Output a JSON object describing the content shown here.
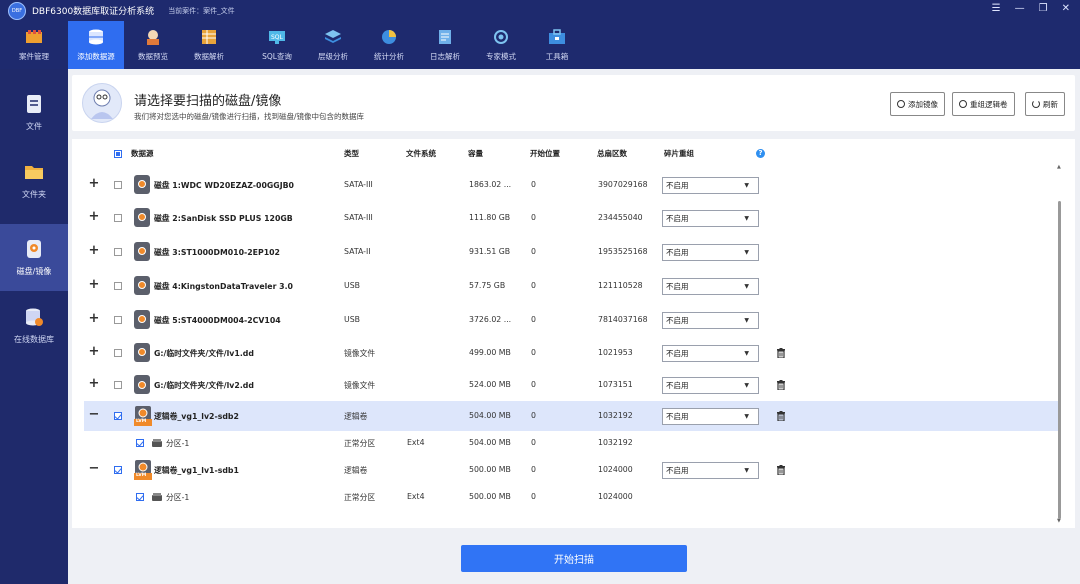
{
  "app": {
    "logo_text": "DBF",
    "title": "DBF6300数据库取证分析系统",
    "case_label": "当前案件：案件_文件"
  },
  "window_controls": [
    "☰",
    "—",
    "❐",
    "✕"
  ],
  "toolbar": [
    {
      "label": "案件管理",
      "icon": "case-icon"
    },
    {
      "label": "添加数据源",
      "icon": "add-datasource-icon",
      "active": true
    },
    {
      "label": "数据预览",
      "icon": "preview-icon"
    },
    {
      "label": "数据解析",
      "icon": "parse-icon"
    },
    {
      "label": "SQL查询",
      "icon": "sql-icon"
    },
    {
      "label": "层级分析",
      "icon": "layer-icon"
    },
    {
      "label": "统计分析",
      "icon": "stats-icon"
    },
    {
      "label": "日志解析",
      "icon": "log-icon"
    },
    {
      "label": "专家模式",
      "icon": "expert-icon"
    },
    {
      "label": "工具箱",
      "icon": "toolbox-icon"
    }
  ],
  "sidebar": [
    {
      "label": "文件",
      "icon": "file-icon"
    },
    {
      "label": "文件夹",
      "icon": "folder-icon"
    },
    {
      "label": "磁盘/镜像",
      "icon": "disk-icon",
      "active": true
    },
    {
      "label": "在线数据库",
      "icon": "database-icon"
    }
  ],
  "header": {
    "title": "请选择要扫描的磁盘/镜像",
    "subtitle": "我们将对您选中的磁盘/镜像进行扫描，找到磁盘/镜像中包含的数据库",
    "btn_add_image": "添加镜像",
    "btn_rebuild": "重组逻辑卷",
    "btn_refresh": "刷新"
  },
  "table": {
    "headers": {
      "source": "数据源",
      "type": "类型",
      "fs": "文件系统",
      "capacity": "容量",
      "start": "开始位置",
      "sectors": "总扇区数",
      "reassemble": "碎片重组"
    },
    "help": "?",
    "rows": [
      {
        "kind": "disk",
        "expander": "+",
        "name": "磁盘 1:WDC WD20EZAZ-00GGJB0",
        "type": "SATA-III",
        "fs": "",
        "capacity": "1863.02 ...",
        "start": "0",
        "sectors": "3907029168",
        "reassemble": "不启用"
      },
      {
        "kind": "disk",
        "expander": "+",
        "name": "磁盘 2:SanDisk SSD PLUS 120GB",
        "type": "SATA-III",
        "fs": "",
        "capacity": "111.80 GB",
        "start": "0",
        "sectors": "234455040",
        "reassemble": "不启用"
      },
      {
        "kind": "disk",
        "expander": "+",
        "name": "磁盘 3:ST1000DM010-2EP102",
        "type": "SATA-II",
        "fs": "",
        "capacity": "931.51 GB",
        "start": "0",
        "sectors": "1953525168",
        "reassemble": "不启用"
      },
      {
        "kind": "disk",
        "expander": "+",
        "name": "磁盘 4:KingstonDataTraveler 3.0",
        "type": "USB",
        "fs": "",
        "capacity": "57.75 GB",
        "start": "0",
        "sectors": "121110528",
        "reassemble": "不启用"
      },
      {
        "kind": "disk",
        "expander": "+",
        "name": "磁盘 5:ST4000DM004-2CV104",
        "type": "USB",
        "fs": "",
        "capacity": "3726.02 ...",
        "start": "0",
        "sectors": "7814037168",
        "reassemble": "不启用"
      },
      {
        "kind": "image",
        "expander": "+",
        "name": "G:/临时文件夹/文件/lv1.dd",
        "type": "镜像文件",
        "fs": "",
        "capacity": "499.00 MB",
        "start": "0",
        "sectors": "1021953",
        "reassemble": "不启用"
      },
      {
        "kind": "image",
        "expander": "+",
        "name": "G:/临时文件夹/文件/lv2.dd",
        "type": "镜像文件",
        "fs": "",
        "capacity": "524.00 MB",
        "start": "0",
        "sectors": "1073151",
        "reassemble": "不启用"
      },
      {
        "kind": "lvm",
        "expander": "−",
        "name": "逻辑卷_vg1_lv2-sdb2",
        "type": "逻辑卷",
        "fs": "",
        "capacity": "504.00 MB",
        "start": "0",
        "sectors": "1032192",
        "reassemble": "不启用",
        "checked": true
      },
      {
        "kind": "part",
        "expander": "",
        "name": "分区-1",
        "type": "正常分区",
        "fs": "Ext4",
        "capacity": "504.00 MB",
        "start": "0",
        "sectors": "1032192",
        "reassemble": "",
        "checked": true
      },
      {
        "kind": "lvm",
        "expander": "−",
        "name": "逻辑卷_vg1_lv1-sdb1",
        "type": "逻辑卷",
        "fs": "",
        "capacity": "500.00 MB",
        "start": "0",
        "sectors": "1024000",
        "reassemble": "不启用",
        "checked": true
      },
      {
        "kind": "part",
        "expander": "",
        "name": "分区-1",
        "type": "正常分区",
        "fs": "Ext4",
        "capacity": "500.00 MB",
        "start": "0",
        "sectors": "1024000",
        "reassemble": "",
        "checked": true
      }
    ]
  },
  "start_button": "开始扫描",
  "lvm_badge": "LVM"
}
